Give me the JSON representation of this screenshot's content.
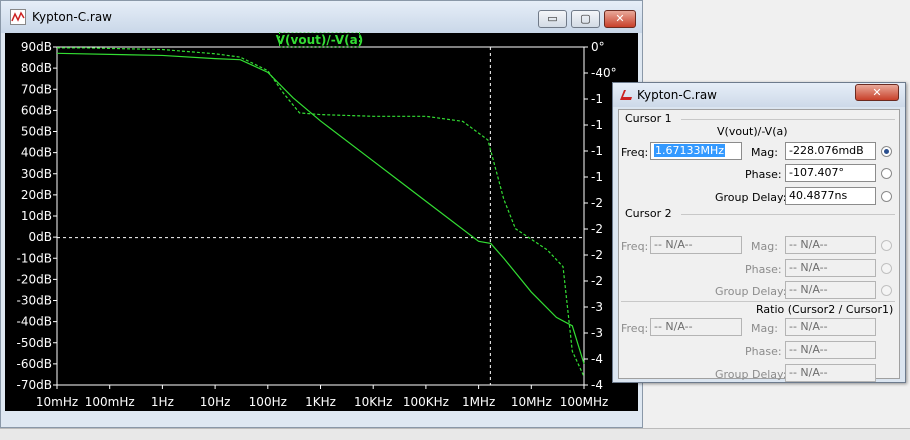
{
  "plot_window": {
    "title": "Kypton-C.raw",
    "icon": "waveform-icon",
    "trace_label": "V(vout)/-V(a)",
    "buttons": {
      "minimize": "▭",
      "maximize": "▢",
      "close": "✕"
    }
  },
  "axes": {
    "mag_ticks": [
      "90dB",
      "80dB",
      "70dB",
      "60dB",
      "50dB",
      "40dB",
      "30dB",
      "20dB",
      "10dB",
      "0dB",
      "-10dB",
      "-20dB",
      "-30dB",
      "-40dB",
      "-50dB",
      "-60dB",
      "-70dB"
    ],
    "phase_ticks": [
      "0°",
      "-40°",
      "-1",
      "-1",
      "-1",
      "-1",
      "-2",
      "-2",
      "-2",
      "-2",
      "-3",
      "-3",
      "-4",
      "-4"
    ],
    "freq_ticks": [
      "10mHz",
      "100mHz",
      "1Hz",
      "10Hz",
      "100Hz",
      "1KHz",
      "10KHz",
      "100KHz",
      "1MHz",
      "10MHz",
      "100MHz"
    ]
  },
  "chart_data": {
    "type": "line",
    "title": "V(vout)/-V(a)",
    "x_scale": "log",
    "x_unit": "Hz",
    "xlim": [
      0.01,
      100000000
    ],
    "ylim_mag_db": [
      -70,
      90
    ],
    "ylim_phase_deg": [
      -400,
      0
    ],
    "series": [
      {
        "name": "",
        "style": "solid",
        "color": "#33dd33",
        "points": [
          [
            0.01,
            87
          ],
          [
            1,
            86
          ],
          [
            10,
            84.5
          ],
          [
            30,
            84
          ],
          [
            100,
            78
          ],
          [
            300,
            66
          ],
          [
            1000,
            55
          ],
          [
            10000,
            36
          ],
          [
            100000,
            17
          ],
          [
            1000000,
            -2
          ],
          [
            1700000,
            -3
          ],
          [
            3000000,
            -10
          ],
          [
            10000000,
            -26
          ],
          [
            30000000,
            -38
          ],
          [
            60000000,
            -42
          ],
          [
            100000000,
            -60
          ]
        ]
      },
      {
        "name": "",
        "style": "dashed",
        "color": "#33dd33",
        "axis": "phase",
        "points": [
          [
            0.01,
            -1
          ],
          [
            0.03,
            -1
          ],
          [
            1,
            -3
          ],
          [
            10,
            -8
          ],
          [
            30,
            -12
          ],
          [
            100,
            -28
          ],
          [
            200,
            -55
          ],
          [
            400,
            -78
          ],
          [
            1000,
            -80
          ],
          [
            10000,
            -82
          ],
          [
            100000,
            -82
          ],
          [
            500000,
            -88
          ],
          [
            1500000,
            -110
          ],
          [
            3000000,
            -180
          ],
          [
            5000000,
            -215
          ],
          [
            20000000,
            -240
          ],
          [
            40000000,
            -260
          ],
          [
            60000000,
            -360
          ],
          [
            100000000,
            -390
          ]
        ]
      }
    ],
    "cursor": {
      "freq": 1671330,
      "mag_db": -0.228
    }
  },
  "dialog": {
    "title": "Kypton-C.raw",
    "cursor1": {
      "group": "Cursor 1",
      "trace": "V(vout)/-V(a)",
      "freq_label": "Freq:",
      "freq_value": "1.67133MHz",
      "mag_label": "Mag:",
      "mag_value": "-228.076mdB",
      "phase_label": "Phase:",
      "phase_value": "-107.407°",
      "gd_label": "Group Delay:",
      "gd_value": "40.4877ns"
    },
    "cursor2": {
      "group": "Cursor 2",
      "freq_label": "Freq:",
      "freq_value": "-- N/A--",
      "mag_label": "Mag:",
      "mag_value": "-- N/A--",
      "phase_label": "Phase:",
      "phase_value": "-- N/A--",
      "gd_label": "Group Delay:",
      "gd_value": "-- N/A--"
    },
    "ratio": {
      "group": "Ratio (Cursor2 / Cursor1)",
      "freq_label": "Freq:",
      "freq_value": "-- N/A--",
      "mag_label": "Mag:",
      "mag_value": "-- N/A--",
      "phase_label": "Phase:",
      "phase_value": "-- N/A--",
      "gd_label": "Group Delay:",
      "gd_value": "-- N/A--"
    },
    "close": "✕"
  }
}
